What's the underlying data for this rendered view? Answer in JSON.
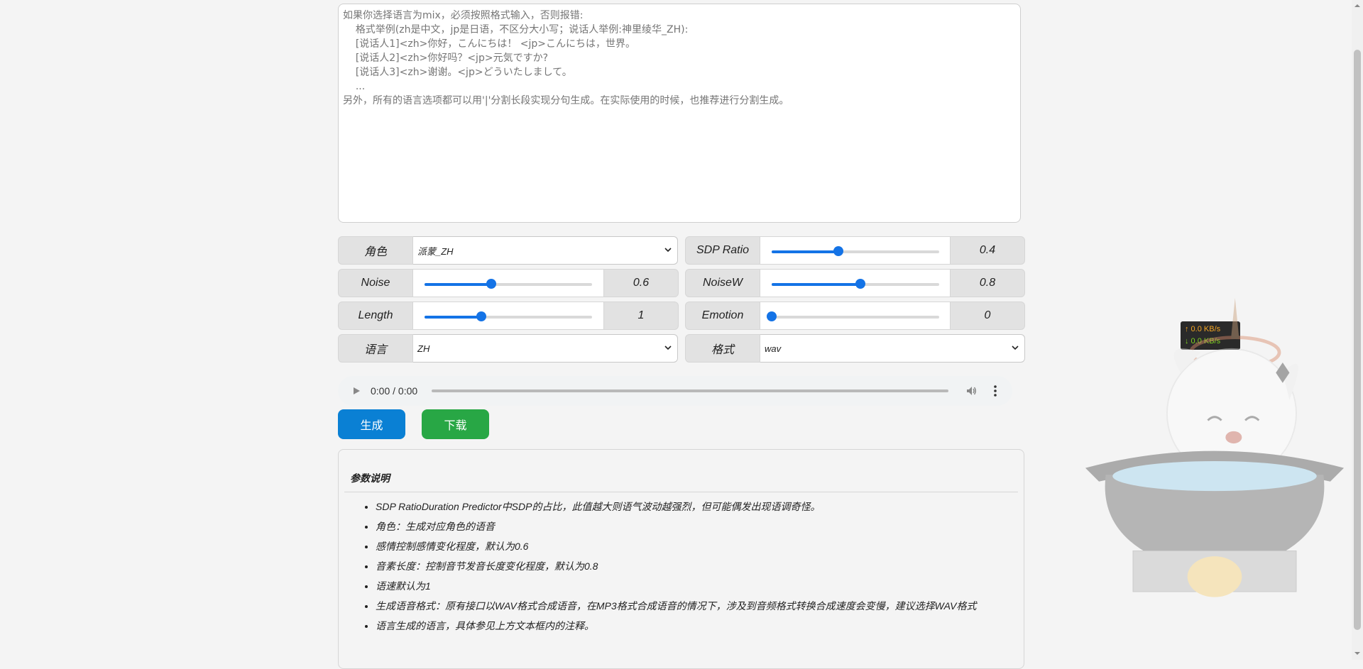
{
  "textarea": {
    "placeholder": "如果你选择语言为mix，必须按照格式输入，否则报错:\n    格式举例(zh是中文，jp是日语，不区分大小写；说话人举例:神里绫华_ZH):\n    [说话人1]<zh>你好，こんにちは！ <jp>こんにちは，世界。\n    [说话人2]<zh>你好吗？<jp>元気ですか?\n    [说话人3]<zh>谢谢。<jp>どういたしまして。\n    ...\n另外，所有的语言选项都可以用'|'分割长段实现分句生成。在实际使用的时候，也推荐进行分割生成。"
  },
  "controls": {
    "speaker": {
      "label": "角色",
      "value": "派蒙_ZH"
    },
    "sdp_ratio": {
      "label": "SDP Ratio",
      "value": "0.4",
      "fraction": 0.4
    },
    "noise": {
      "label": "Noise",
      "value": "0.6",
      "fraction": 0.4
    },
    "noisew": {
      "label": "NoiseW",
      "value": "0.8",
      "fraction": 0.53
    },
    "length": {
      "label": "Length",
      "value": "1",
      "fraction": 0.34
    },
    "emotion": {
      "label": "Emotion",
      "value": "0",
      "fraction": 0.0
    },
    "language": {
      "label": "语言",
      "value": "ZH"
    },
    "format": {
      "label": "格式",
      "value": "wav"
    }
  },
  "audio": {
    "time": "0:00 / 0:00"
  },
  "buttons": {
    "generate": "生成",
    "download": "下载",
    "generate_color": "#0a80d4",
    "download_color": "#28a745"
  },
  "panel": {
    "title": "参数说明",
    "items": [
      "SDP RatioDuration Predictor中SDP的占比，此值越大则语气波动越强烈，但可能偶发出现语调奇怪。",
      "角色：生成对应角色的语音",
      "感情控制感情变化程度，默认为0.6",
      "音素长度：控制音节发音长度变化程度，默认为0.8",
      "语速默认为1",
      "生成语音格式：原有接口以WAV格式合成语音，在MP3格式合成语音的情况下，涉及到音频格式转换合成速度会变慢，建议选择WAV格式",
      "语言生成的语言，具体参见上方文本框内的注释。"
    ]
  },
  "net_speed": {
    "up": "↑ 0.0 KB/s",
    "down": "↓ 0.0 KB/s",
    "up_color": "#f5a623",
    "down_color": "#7ed321"
  }
}
